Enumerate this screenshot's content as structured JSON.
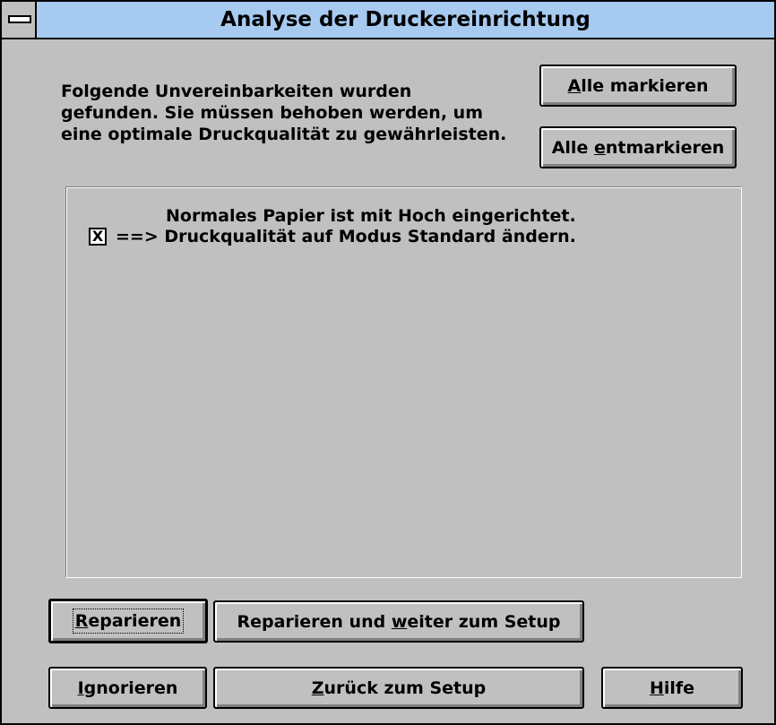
{
  "window": {
    "title": "Analyse der Druckereinrichtung"
  },
  "intro": {
    "text": "Folgende Unvereinbarkeiten wurden\ngefunden. Sie müssen behoben werden, um\neine optimale Druckqualität zu gewährleisten."
  },
  "buttons": {
    "mark_all": {
      "pre": "",
      "mn": "A",
      "post": "lle markieren"
    },
    "unmark_all": {
      "pre": "Alle ",
      "mn": "e",
      "post": "ntmarkieren"
    },
    "repair": {
      "pre": "",
      "mn": "R",
      "post": "eparieren"
    },
    "repair_setup": {
      "pre": "Reparieren und ",
      "mn": "w",
      "post": "eiter zum Setup"
    },
    "ignore": {
      "pre": "",
      "mn": "I",
      "post": "gnorieren"
    },
    "back": {
      "pre": "",
      "mn": "Z",
      "post": "urück zum Setup"
    },
    "help": {
      "pre": "",
      "mn": "H",
      "post": "ilfe"
    }
  },
  "issues": [
    {
      "problem": "Normales Papier ist mit Hoch eingerichtet.",
      "checked": true,
      "check_mark": "X",
      "fix": "==> Druckqualität auf Modus Standard ändern."
    }
  ]
}
